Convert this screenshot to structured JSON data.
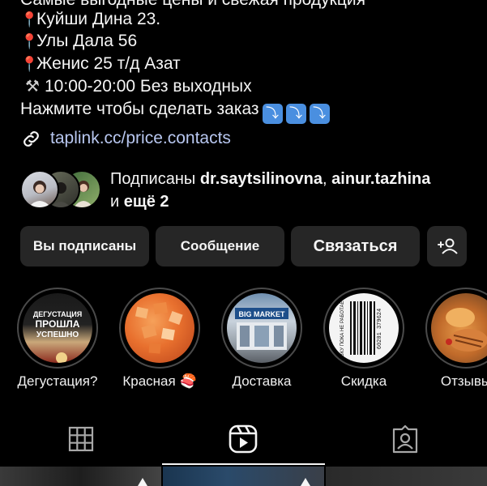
{
  "bio": {
    "truncated_line": "Самые выгодные цены и свежая продукция",
    "addresses": [
      "Куйши Дина 23.",
      "Улы Дала 56",
      "Женис 25 т/д Азат"
    ],
    "hours": "10:00-20:00 Без выходных",
    "order_cta": "Нажмите чтобы сделать заказ"
  },
  "link": {
    "text": "taplink.cc/price.contacts"
  },
  "followers": {
    "prefix": "Подписаны ",
    "user1": "dr.saytsilinovna",
    "separator": ", ",
    "user2": "ainur.tazhina",
    "and_text": "и ",
    "more": "ещё 2"
  },
  "buttons": {
    "following": "Вы подписаны",
    "message": "Сообщение",
    "contact": "Связаться"
  },
  "highlights": [
    {
      "label": "Дегустация?",
      "cover_text": "ДЕГУСТАЦИЯ ПРОШЛА УСПЕШНО"
    },
    {
      "label": "Красная 🍣"
    },
    {
      "label": "Доставка",
      "cover_text": "BIG MARKET"
    },
    {
      "label": "Скидка",
      "cover_text": "АВКУ ПОКА НЕ РАБОТАЕТ 60201 379624"
    },
    {
      "label": "Отзывы"
    }
  ],
  "tabs": {
    "icons": [
      "grid-icon",
      "reels-icon",
      "tagged-icon"
    ],
    "active_index": 1
  },
  "colors": {
    "background": "#000000",
    "button_bg": "#262626",
    "link": "#b8c7f0",
    "pin": "#e0344b",
    "arrow_emoji": "#4a8fe0"
  }
}
